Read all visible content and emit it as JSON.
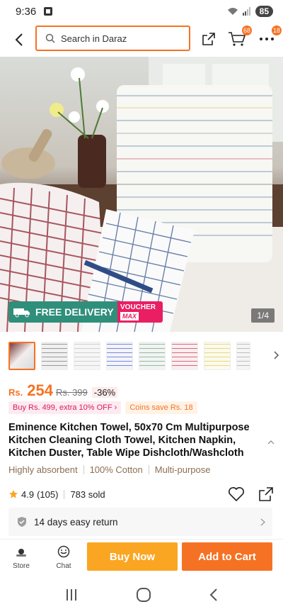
{
  "status_bar": {
    "time": "9:36",
    "battery": "85"
  },
  "header": {
    "search_placeholder": "Search in Daraz",
    "cart_badge": "68",
    "more_badge": "18"
  },
  "hero": {
    "free_delivery": "FREE DELIVERY",
    "voucher_line1": "VOUCHER",
    "voucher_line2": "MAX",
    "page_indicator": "1/4"
  },
  "product": {
    "currency": "Rs.",
    "price": "254",
    "original_price": "Rs. 399",
    "discount": "-36%",
    "promo_buy": "Buy Rs. 499, extra 10% OFF",
    "promo_coins": "Coins save Rs. 18",
    "title": "Eminence Kitchen Towel, 50x70 Cm Multipurpose Kitchen Cleaning Cloth Towel, Kitchen Napkin, Kitchen Duster, Table Wipe Dishcloth/Washcloth",
    "features": [
      "Highly absorbent",
      "100% Cotton",
      "Multi-purpose"
    ],
    "rating": "4.9",
    "reviews": "(105)",
    "sold": "783 sold",
    "return_policy": "14 days easy return"
  },
  "action_bar": {
    "store": "Store",
    "chat": "Chat",
    "buy_now": "Buy Now",
    "add_to_cart": "Add to Cart"
  },
  "colors": {
    "accent": "#f57224",
    "buy": "#faa622",
    "delivery": "#2f8f7a",
    "voucher": "#e91e63"
  }
}
